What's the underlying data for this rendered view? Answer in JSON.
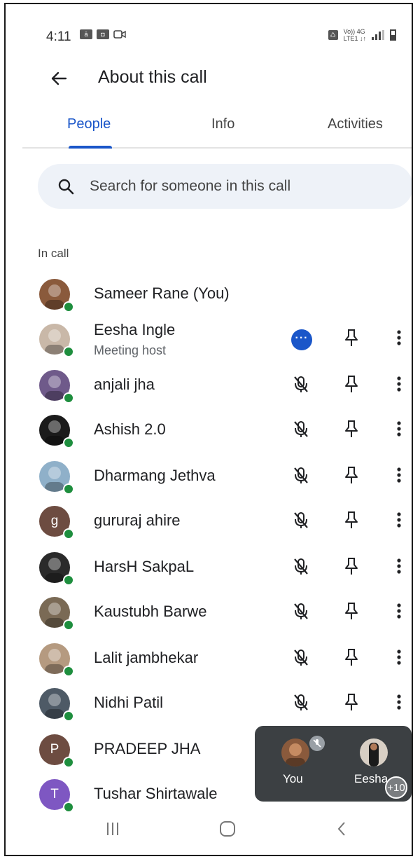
{
  "status_bar": {
    "time": "4:11",
    "network_label_top": "Vo)) 4G",
    "network_label_bottom": "LTE1 ↓↑"
  },
  "header": {
    "title": "About this call"
  },
  "tabs": [
    {
      "label": "People",
      "active": true
    },
    {
      "label": "Info",
      "active": false
    },
    {
      "label": "Activities",
      "active": false
    }
  ],
  "search": {
    "placeholder": "Search for someone in this call"
  },
  "section_label": "In call",
  "participants": [
    {
      "name": "Sameer Rane (You)",
      "subtitle": "",
      "avatar_letter": "",
      "avatar_color": "#8a5a3c"
    },
    {
      "name": "Eesha Ingle",
      "subtitle": "Meeting host",
      "avatar_letter": "",
      "avatar_color": "#c9b8a8"
    },
    {
      "name": "anjali jha",
      "subtitle": "",
      "avatar_letter": "",
      "avatar_color": "#6f5a8a"
    },
    {
      "name": "Ashish 2.0",
      "subtitle": "",
      "avatar_letter": "",
      "avatar_color": "#1b1b1b"
    },
    {
      "name": "Dharmang Jethva",
      "subtitle": "",
      "avatar_letter": "",
      "avatar_color": "#8fb0c9"
    },
    {
      "name": "gururaj ahire",
      "subtitle": "",
      "avatar_letter": "g",
      "avatar_color": "#6d4c41"
    },
    {
      "name": "HarsH SakpaL",
      "subtitle": "",
      "avatar_letter": "",
      "avatar_color": "#2a2a2a"
    },
    {
      "name": "Kaustubh Barwe",
      "subtitle": "",
      "avatar_letter": "",
      "avatar_color": "#7a6a55"
    },
    {
      "name": "Lalit jambhekar",
      "subtitle": "",
      "avatar_letter": "",
      "avatar_color": "#b59a80"
    },
    {
      "name": "Nidhi Patil",
      "subtitle": "",
      "avatar_letter": "",
      "avatar_color": "#4e5a66"
    },
    {
      "name": "PRADEEP JHA",
      "subtitle": "",
      "avatar_letter": "P",
      "avatar_color": "#6d4c41"
    },
    {
      "name": "Tushar Shirtawale",
      "subtitle": "",
      "avatar_letter": "T",
      "avatar_color": "#7e57c2"
    }
  ],
  "pip": {
    "you_label": "You",
    "other_label": "Eesha",
    "more_count": "+10"
  },
  "colors": {
    "accent": "#1a56c9",
    "online": "#1e8e3e",
    "pip_bg": "#3c4043"
  }
}
